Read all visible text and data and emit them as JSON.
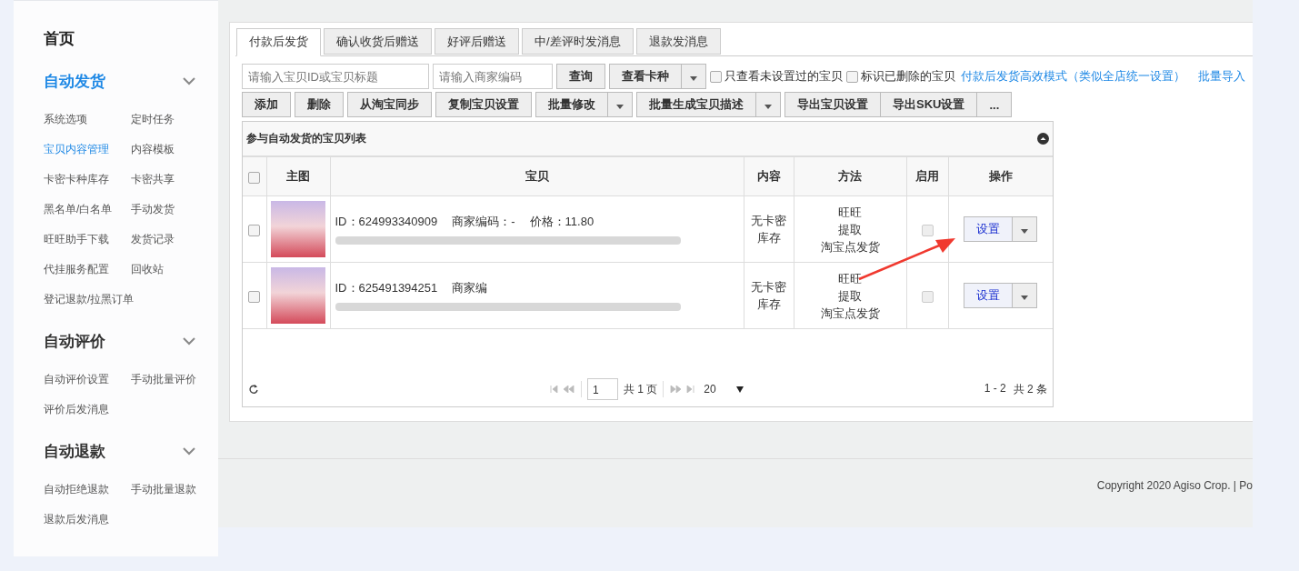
{
  "sidebar": {
    "home": "首页",
    "groups": [
      {
        "title": "自动发货",
        "selected": true,
        "expanded": true,
        "items": [
          {
            "label": "系统选项",
            "selected": false
          },
          {
            "label": "定时任务",
            "selected": false
          },
          {
            "label": "宝贝内容管理",
            "selected": true
          },
          {
            "label": "内容模板",
            "selected": false
          },
          {
            "label": "卡密卡种库存",
            "selected": false
          },
          {
            "label": "卡密共享",
            "selected": false
          },
          {
            "label": "黑名单/白名单",
            "selected": false
          },
          {
            "label": "手动发货",
            "selected": false
          },
          {
            "label": "旺旺助手下载",
            "selected": false
          },
          {
            "label": "发货记录",
            "selected": false
          },
          {
            "label": "代挂服务配置",
            "selected": false
          },
          {
            "label": "回收站",
            "selected": false
          },
          {
            "label": "登记退款/拉黑订单",
            "selected": false
          }
        ]
      },
      {
        "title": "自动评价",
        "selected": false,
        "expanded": true,
        "items": [
          {
            "label": "自动评价设置",
            "selected": false
          },
          {
            "label": "手动批量评价",
            "selected": false
          },
          {
            "label": "评价后发消息",
            "selected": false
          }
        ]
      },
      {
        "title": "自动退款",
        "selected": false,
        "expanded": true,
        "items": [
          {
            "label": "自动拒绝退款",
            "selected": false
          },
          {
            "label": "手动批量退款",
            "selected": false
          },
          {
            "label": "退款后发消息",
            "selected": false
          }
        ]
      }
    ]
  },
  "tabs": [
    {
      "label": "付款后发货",
      "selected": true
    },
    {
      "label": "确认收货后赠送",
      "selected": false
    },
    {
      "label": "好评后赠送",
      "selected": false
    },
    {
      "label": "中/差评时发消息",
      "selected": false
    },
    {
      "label": "退款发消息",
      "selected": false
    }
  ],
  "search": {
    "title_placeholder": "请输入宝贝ID或宝贝标题",
    "code_placeholder": "请输入商家编码",
    "buttons": [
      {
        "label": "查询",
        "kind": "plain"
      },
      {
        "label": "查看卡种",
        "kind": "split"
      }
    ],
    "filters": [
      {
        "label": "只查看未设置过的宝贝",
        "checked": false
      },
      {
        "label": "标识已删除的宝贝",
        "checked": false
      }
    ],
    "links": [
      "付款后发货高效模式（类似全店统一设置）",
      "批量导入"
    ]
  },
  "actions": [
    {
      "label": "添加",
      "kind": "plain"
    },
    {
      "label": "删除",
      "kind": "plain"
    },
    {
      "label": "从淘宝同步",
      "kind": "plain"
    },
    {
      "label": "复制宝贝设置",
      "kind": "plain"
    },
    {
      "label": "批量修改",
      "kind": "split"
    },
    {
      "label": "批量生成宝贝描述",
      "kind": "split"
    },
    {
      "label": "导出宝贝设置",
      "kind": "joined"
    },
    {
      "label": "导出SKU设置",
      "kind": "joined"
    },
    {
      "label": "...",
      "kind": "joined"
    }
  ],
  "grid": {
    "title": "参与自动发货的宝贝列表",
    "all_checked": false,
    "columns": [
      "主图",
      "宝贝",
      "内容",
      "方法",
      "启用",
      "操作"
    ],
    "rows": [
      {
        "checked": false,
        "info": [
          "ID：624993340909",
          "商家编码：-",
          "价格：11.80"
        ],
        "content": [
          "无卡密",
          "库存"
        ],
        "method": [
          "旺旺",
          "提取",
          "淘宝点发货"
        ],
        "enabled": false,
        "action": "设置"
      },
      {
        "checked": false,
        "info": [
          "ID：625491394251",
          "商家编"
        ],
        "content": [
          "无卡密",
          "库存"
        ],
        "method": [
          "旺旺",
          "提取",
          "淘宝点发货"
        ],
        "enabled": false,
        "action": "设置"
      }
    ],
    "pager": {
      "page": "1",
      "pages": "共 1 页",
      "size": "20",
      "range": "1 - 2",
      "total": "共 2 条"
    }
  },
  "footer": {
    "copyright": "Copyright 2020 Agiso Crop. | Po"
  }
}
